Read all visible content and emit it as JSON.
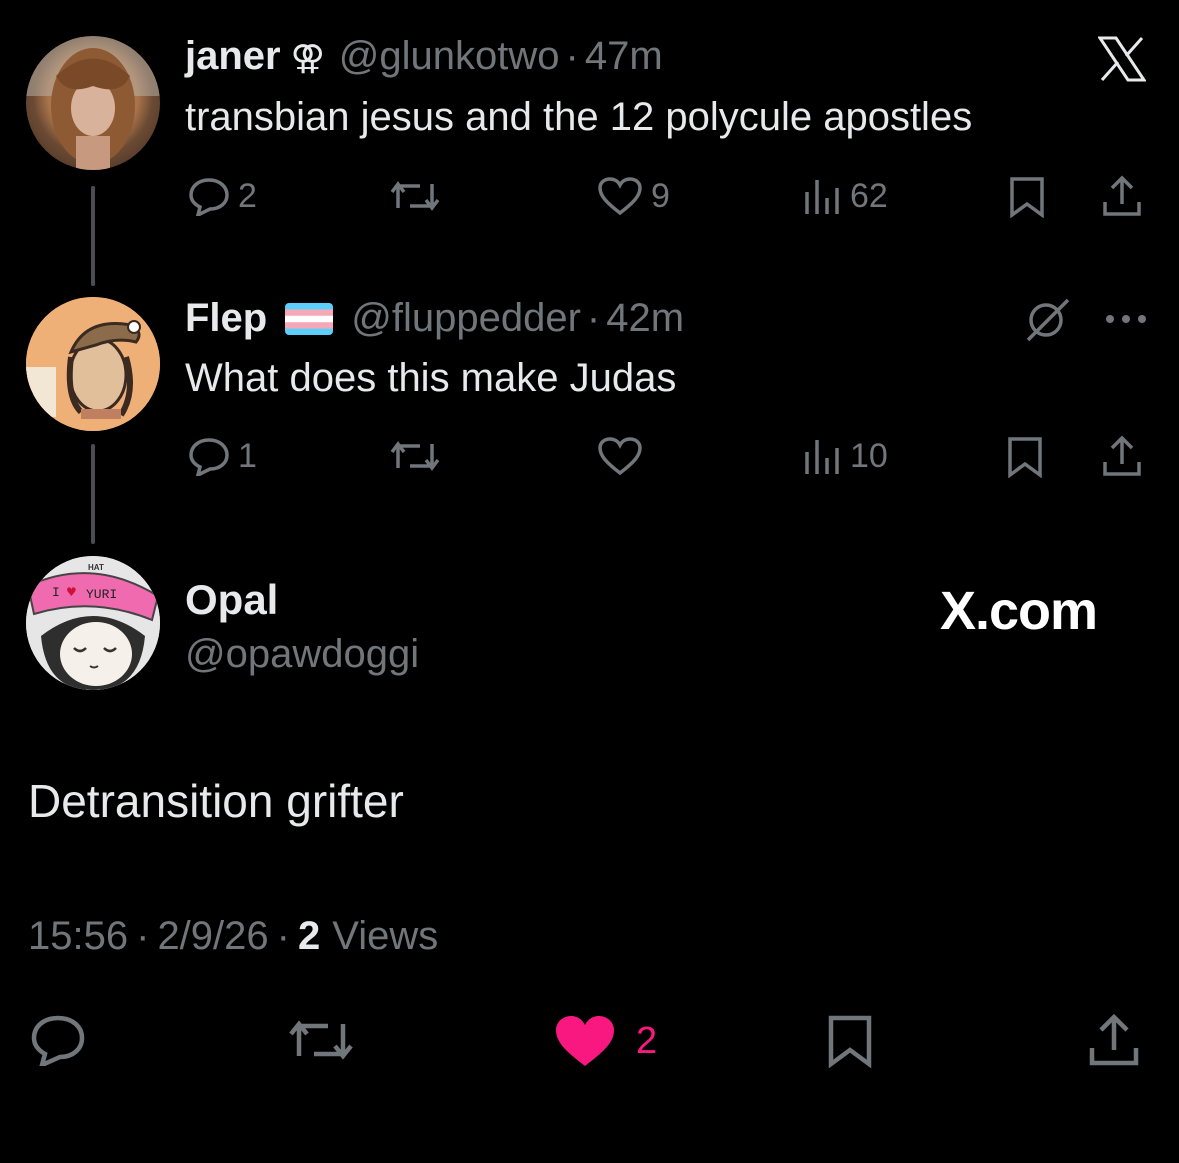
{
  "tweets": [
    {
      "name": "janer",
      "name_emoji": "⚢",
      "handle": "@glunkotwo",
      "sep": "·",
      "time": "47m",
      "text": "transbian jesus and the 12 polycule apostles",
      "replies": "2",
      "likes": "9",
      "views": "62"
    },
    {
      "name": "Flep",
      "handle": "@fluppedder",
      "sep": "·",
      "time": "42m",
      "text": "What does this make Judas",
      "replies": "1",
      "views": "10"
    }
  ],
  "main_tweet": {
    "name": "Opal",
    "handle": "@opawdoggi",
    "avatar_text_top": "HAT",
    "avatar_text_left": "I",
    "avatar_text_right": "YURI",
    "text": "Detransition grifter",
    "time": "15:56",
    "date": "2/9/26",
    "views_count": "2",
    "views_label": "Views",
    "sep": "·",
    "likes": "2"
  },
  "watermark": "X.com",
  "colors": {
    "like_active": "#f91880",
    "muted": "#71767b",
    "text": "#e7e9ea",
    "background": "#000000"
  }
}
